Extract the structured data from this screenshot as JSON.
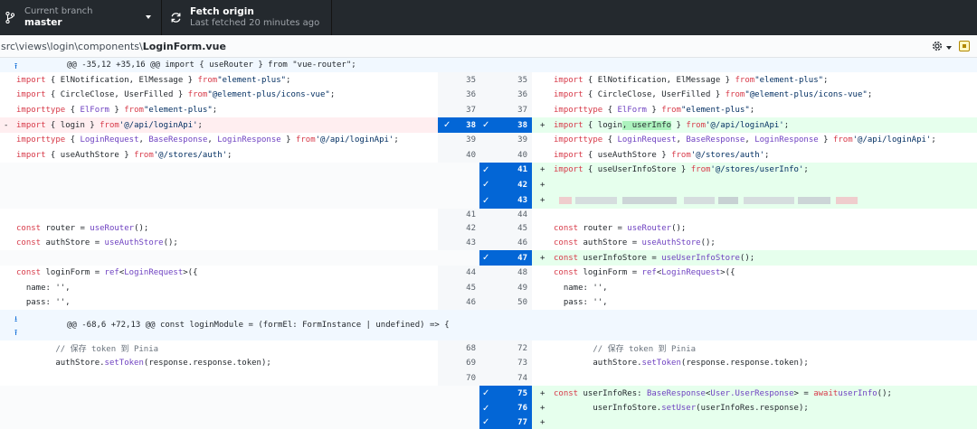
{
  "toolbar": {
    "branch_label": "Current branch",
    "branch_name": "master",
    "fetch_title": "Fetch origin",
    "fetch_sub": "Last fetched 20 minutes ago"
  },
  "file": {
    "dirs": "src\\views\\login\\components\\",
    "name": "LoginForm.vue"
  },
  "hunks": [
    "@@ -35,12 +35,16 @@ import { useRouter } from \"vue-router\";",
    "@@ -68,6 +72,13 @@ const loginModule = (formEl: FormInstance | undefined) => {"
  ],
  "lines": [
    {
      "l": "import { ElNotification, ElMessage } from \"element-plus\";",
      "ln": "35",
      "rn": "35",
      "r": "import { ElNotification, ElMessage } from \"element-plus\";"
    },
    {
      "l": "import { CircleClose, UserFilled } from \"@element-plus/icons-vue\";",
      "ln": "36",
      "rn": "36",
      "r": "import { CircleClose, UserFilled } from \"@element-plus/icons-vue\";"
    },
    {
      "l": "import type { ElForm } from \"element-plus\";",
      "ln": "37",
      "rn": "37",
      "r": "import type { ElForm } from \"element-plus\";"
    },
    {
      "l": "import { login } from '@/api/loginApi';",
      "ln": "38",
      "rn": "38",
      "r": "import { login, userInfo } from '@/api/loginApi';"
    },
    {
      "l": "import type { LoginRequest, BaseResponse, LoginResponse } from '@/api/loginApi';",
      "ln": "39",
      "rn": "39",
      "r": "import type { LoginRequest, BaseResponse, LoginResponse } from '@/api/loginApi';"
    },
    {
      "l": "import { useAuthStore } from '@/stores/auth';",
      "ln": "40",
      "rn": "40",
      "r": "import { useAuthStore } from '@/stores/auth';"
    },
    {
      "rn": "41",
      "r": "import { useUserInfoStore } from '@/stores/userInfo';"
    },
    {
      "rn": "42",
      "r": ""
    },
    {
      "rn": "43",
      "r": ""
    },
    {
      "ln": "41",
      "rn": "44"
    },
    {
      "l": "const router = useRouter();",
      "ln": "42",
      "rn": "45",
      "r": "const router = useRouter();"
    },
    {
      "l": "const authStore = useAuthStore();",
      "ln": "43",
      "rn": "46",
      "r": "const authStore = useAuthStore();"
    },
    {
      "rn": "47",
      "r": "const userInfoStore = useUserInfoStore();"
    },
    {
      "l": "const loginForm = ref<LoginRequest>({",
      "ln": "44",
      "rn": "48",
      "r": "const loginForm = ref<LoginRequest>({"
    },
    {
      "l": "  name: '',",
      "ln": "45",
      "rn": "49",
      "r": "  name: '',"
    },
    {
      "l": "  pass: '',",
      "ln": "46",
      "rn": "50",
      "r": "  pass: '',"
    },
    {
      "l": "        // 保存 token 到 Pinia",
      "ln": "68",
      "rn": "72",
      "r": "        // 保存 token 到 Pinia"
    },
    {
      "l": "        authStore.setToken(response.response.token);",
      "ln": "69",
      "rn": "73",
      "r": "        authStore.setToken(response.response.token);"
    },
    {
      "ln": "70",
      "rn": "74"
    },
    {
      "rn": "75",
      "r": "        const userInfoRes: BaseResponse<User.UserResponse> = await userInfo();"
    },
    {
      "rn": "76",
      "r": "        userInfoStore.setUser(userInfoRes.response);"
    },
    {
      "rn": "77",
      "r": ""
    }
  ],
  "markers": {
    "add": "+",
    "del": "-",
    "check": "✓"
  },
  "colors": {
    "accent": "#0366d6",
    "add_bg": "#e6ffed",
    "del_bg": "#ffeef0",
    "hunk_bg": "#f1f8ff"
  }
}
